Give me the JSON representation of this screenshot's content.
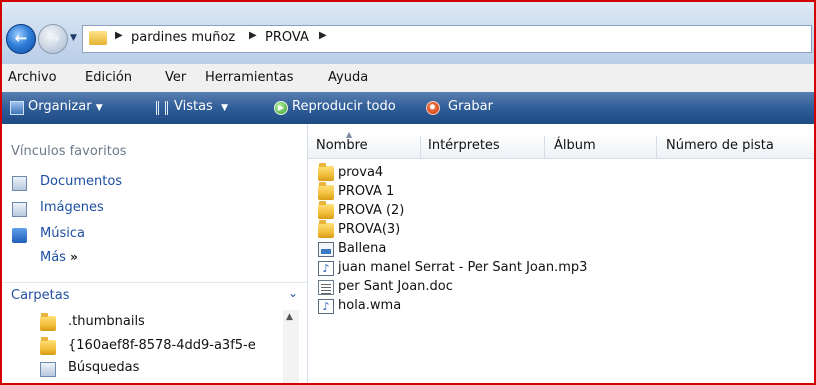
{
  "address": {
    "crumbs": [
      "pardines muñoz",
      "PROVA"
    ]
  },
  "menu": [
    "Archivo",
    "Edición",
    "Ver",
    "Herramientas",
    "Ayuda"
  ],
  "commands": {
    "organize": "Organizar",
    "views": "Vistas",
    "play_all": "Reproducir todo",
    "burn": "Grabar"
  },
  "nav": {
    "favorites_header": "Vínculos favoritos",
    "favorites": [
      {
        "label": "Documentos",
        "icon": "documents-icon"
      },
      {
        "label": "Imágenes",
        "icon": "pictures-icon"
      },
      {
        "label": "Música",
        "icon": "music-icon"
      }
    ],
    "more": "Más",
    "folders_header": "Carpetas",
    "tree": [
      {
        "label": ".thumbnails",
        "icon": "folder-icon"
      },
      {
        "label": "{160aef8f-8578-4dd9-a3f5-e",
        "icon": "folder-icon"
      },
      {
        "label": "Búsquedas",
        "icon": "search-folder-icon"
      }
    ]
  },
  "columns": [
    "Nombre",
    "Intérpretes",
    "Álbum",
    "Número de pista"
  ],
  "files": [
    {
      "name": "prova4",
      "icon": "folder-icon"
    },
    {
      "name": "PROVA 1",
      "icon": "folder-icon"
    },
    {
      "name": "PROVA (2)",
      "icon": "folder-icon"
    },
    {
      "name": "PROVA(3)",
      "icon": "folder-icon"
    },
    {
      "name": "Ballena",
      "icon": "image-file-icon"
    },
    {
      "name": "juan manel Serrat - Per Sant Joan.mp3",
      "icon": "audio-file-icon"
    },
    {
      "name": "per Sant Joan.doc",
      "icon": "document-file-icon"
    },
    {
      "name": "hola.wma",
      "icon": "audio-file-icon"
    }
  ],
  "colors": {
    "border": "#d40000",
    "link": "#1c4fa0",
    "command_bar": "#2f5d97"
  }
}
